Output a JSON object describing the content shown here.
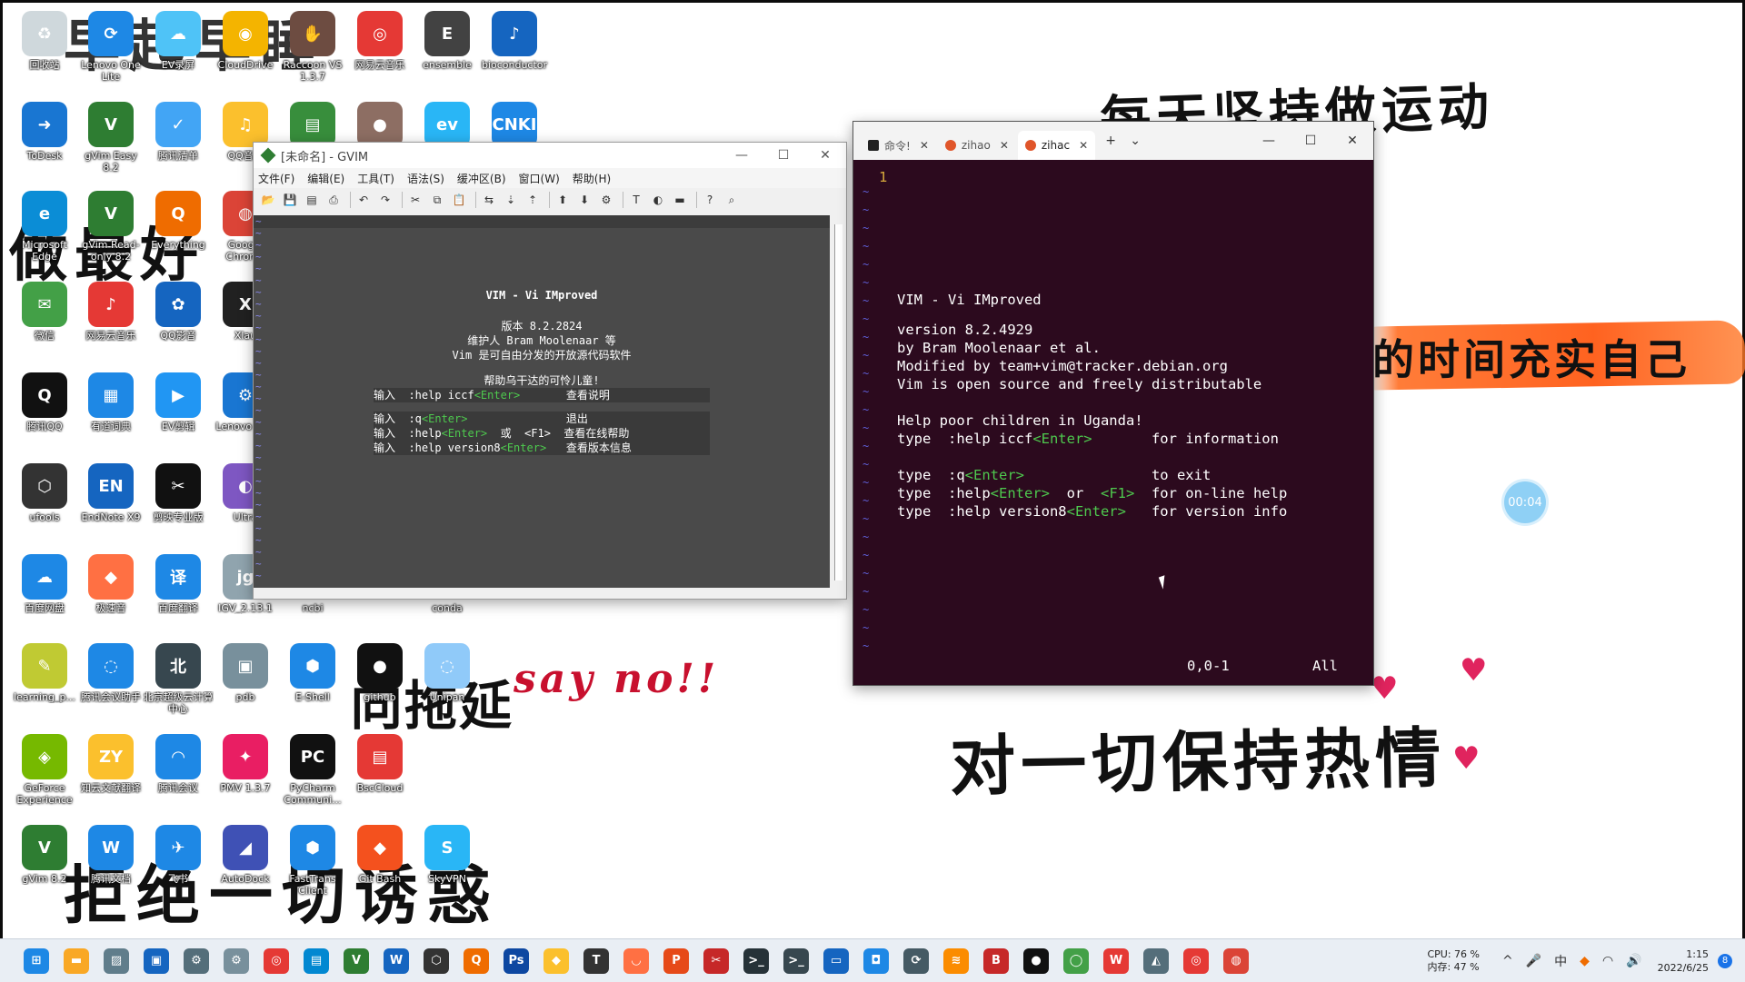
{
  "wallpaper": {
    "line1": "每天坚持做运动",
    "line2": "对一切保持热情",
    "line3": "say no!!",
    "line4": "向拖延",
    "line5": "拒绝一切诱惑",
    "line6": "早起早睡",
    "line7": "做最好",
    "line8": "的时间充实自己",
    "heart": "♥",
    "recorder_time": "00:04"
  },
  "desktop_icons": [
    {
      "label": "回收站",
      "glyph": "♻",
      "color": "#cfd8dc"
    },
    {
      "label": "Lenovo One Lite",
      "glyph": "⟳",
      "color": "#1e88e5"
    },
    {
      "label": "EV录屏",
      "glyph": "☁",
      "color": "#4fc3f7"
    },
    {
      "label": "CloudDrive",
      "glyph": "◉",
      "color": "#f4b400"
    },
    {
      "label": "Raccoon VS 1.3.7",
      "glyph": "✋",
      "color": "#6d4c41"
    },
    {
      "label": "网易云音乐",
      "glyph": "◎",
      "color": "#e53935"
    },
    {
      "label": "ensemble",
      "glyph": "E",
      "color": "#424242"
    },
    {
      "label": "bioconductor",
      "glyph": "♪",
      "color": "#1565c0"
    },
    {
      "label": "ToDesk",
      "glyph": "➜",
      "color": "#1976d2"
    },
    {
      "label": "gVim Easy 8.2",
      "glyph": "V",
      "color": "#2e7d32"
    },
    {
      "label": "腾讯清单",
      "glyph": "✓",
      "color": "#42a5f5"
    },
    {
      "label": "QQ音乐",
      "glyph": "♫",
      "color": "#fbc02d"
    },
    {
      "label": "",
      "glyph": "▤",
      "color": "#388e3c"
    },
    {
      "label": "",
      "glyph": "●",
      "color": "#8d6e63"
    },
    {
      "label": "",
      "glyph": "ev",
      "color": "#29b6f6"
    },
    {
      "label": "",
      "glyph": "CNKI",
      "color": "#1e88e5"
    },
    {
      "label": "Microsoft Edge",
      "glyph": "e",
      "color": "#0b8dd6"
    },
    {
      "label": "gVim Read-only 8.2",
      "glyph": "V",
      "color": "#2e7d32"
    },
    {
      "label": "Everything",
      "glyph": "Q",
      "color": "#ef6c00"
    },
    {
      "label": "Google Chrome",
      "glyph": "◍",
      "color": "#db4437"
    },
    {
      "label": "微信",
      "glyph": "✉",
      "color": "#43a047"
    },
    {
      "label": "网易云音乐",
      "glyph": "♪",
      "color": "#e53935"
    },
    {
      "label": "QQ影音",
      "glyph": "✿",
      "color": "#1565c0"
    },
    {
      "label": "Xlau",
      "glyph": "X",
      "color": "#212121"
    },
    {
      "label": "腾讯QQ",
      "glyph": "Q",
      "color": "#111111"
    },
    {
      "label": "有道词典",
      "glyph": "▦",
      "color": "#1e88e5"
    },
    {
      "label": "EV剪辑",
      "glyph": "▶",
      "color": "#2196f3"
    },
    {
      "label": "Lenovo 驱动",
      "glyph": "⚙",
      "color": "#1976d2"
    },
    {
      "label": "ufools",
      "glyph": "⬡",
      "color": "#333333"
    },
    {
      "label": "EndNote X9",
      "glyph": "EN",
      "color": "#1565c0"
    },
    {
      "label": "剪映专业版",
      "glyph": "✂",
      "color": "#111111"
    },
    {
      "label": "Ultra",
      "glyph": "◐",
      "color": "#7e57c2"
    },
    {
      "label": "百度网盘",
      "glyph": "☁",
      "color": "#1e88e5"
    },
    {
      "label": "极速音",
      "glyph": "◆",
      "color": "#ff7043"
    },
    {
      "label": "百度翻译",
      "glyph": "译",
      "color": "#1e88e5"
    },
    {
      "label": "IGV_2.13.1",
      "glyph": "jg",
      "color": "#90a4ae"
    },
    {
      "label": "ncbi",
      "glyph": "",
      "color": "transparent"
    },
    {
      "label": "conda",
      "glyph": "",
      "color": "transparent"
    },
    {
      "label": "learning_p...",
      "glyph": "✎",
      "color": "#c0ca33"
    },
    {
      "label": "腾讯会议助手",
      "glyph": "◌",
      "color": "#1e88e5"
    },
    {
      "label": "北京超级云计算中心",
      "glyph": "北",
      "color": "#37474f"
    },
    {
      "label": "pdb",
      "glyph": "▣",
      "color": "#78909c"
    },
    {
      "label": "E-Shell",
      "glyph": "⬢",
      "color": "#1e88e5"
    },
    {
      "label": "github",
      "glyph": "●",
      "color": "#111111"
    },
    {
      "label": "Unipan",
      "glyph": "◌",
      "color": "#90caf9"
    },
    {
      "label": "GeForce Experience",
      "glyph": "◈",
      "color": "#76b900"
    },
    {
      "label": "知云文献翻译",
      "glyph": "ZY",
      "color": "#fbc02d"
    },
    {
      "label": "腾讯会议",
      "glyph": "◠",
      "color": "#1e88e5"
    },
    {
      "label": "PMV 1.3.7",
      "glyph": "✦",
      "color": "#e91e63"
    },
    {
      "label": "PyCharm Communi...",
      "glyph": "PC",
      "color": "#111111"
    },
    {
      "label": "BscCloud",
      "glyph": "▤",
      "color": "#e53935"
    },
    {
      "label": "gVim 8.2",
      "glyph": "V",
      "color": "#2e7d32"
    },
    {
      "label": "腾讯文档",
      "glyph": "W",
      "color": "#1e88e5"
    },
    {
      "label": "飞书",
      "glyph": "✈",
      "color": "#1e88e5"
    },
    {
      "label": "AutoDock",
      "glyph": "◢",
      "color": "#3f51b5"
    },
    {
      "label": "FastTrans Client",
      "glyph": "⬢",
      "color": "#1e88e5"
    },
    {
      "label": "Git Bash",
      "glyph": "◆",
      "color": "#f4511e"
    },
    {
      "label": "SkyVPN",
      "glyph": "S",
      "color": "#29b6f6"
    }
  ],
  "gvim": {
    "title": "[未命名] - GVIM",
    "menu": [
      "文件(F)",
      "编辑(E)",
      "工具(T)",
      "语法(S)",
      "缓冲区(B)",
      "窗口(W)",
      "帮助(H)"
    ],
    "toolbar_icons": [
      "open-icon",
      "save-icon",
      "save-all-icon",
      "print-icon",
      "undo-icon",
      "redo-icon",
      "cut-icon",
      "copy-icon",
      "paste-icon",
      "replace-icon",
      "find-next-icon",
      "find-prev-icon",
      "load-session-icon",
      "save-session-icon",
      "run-script-icon",
      "make-icon",
      "shell-icon",
      "tags-icon",
      "help-icon",
      "find-help-icon"
    ],
    "toolbar_glyphs": [
      "📂",
      "💾",
      "▤",
      "⎙",
      "↶",
      "↷",
      "✂",
      "⧉",
      "📋",
      "⇆",
      "⇣",
      "⇡",
      "⬆",
      "⬇",
      "⚙",
      "T",
      "◐",
      "▬",
      "?",
      "⌕"
    ],
    "intro": {
      "title": "VIM - Vi IMproved",
      "version": "版本 8.2.2824",
      "maintainer": "维护人 Bram Moolenaar 等",
      "license": "Vim 是可自由分发的开放源代码软件",
      "help_title": "帮助乌干达的可怜儿童!",
      "rows": [
        {
          "a": "输入  ",
          "b": ":help iccf",
          "c": "<Enter>",
          "d": "       查看说明"
        },
        {
          "a": "输入  ",
          "b": ":q",
          "c": "<Enter>",
          "d": "               退出"
        },
        {
          "a": "输入  ",
          "b": ":help",
          "c": "<Enter>",
          "d": "  或  <F1>  查看在线帮助"
        },
        {
          "a": "输入  ",
          "b": ":help version8",
          "c": "<Enter>",
          "d": "   查看版本信息"
        }
      ]
    }
  },
  "terminal": {
    "tabs": [
      {
        "label": "命令!",
        "icon": "cmd"
      },
      {
        "label": "zihao",
        "icon": "ubuntu"
      },
      {
        "label": "zihac",
        "icon": "ubuntu"
      }
    ],
    "new_tab": "+",
    "dropdown": "⌄",
    "line_number": "1",
    "lines": [
      {
        "text": "VIM - Vi IMproved",
        "indent": 18
      },
      {
        "text": "",
        "indent": 0
      },
      {
        "text": "version 8.2.4929",
        "indent": 19
      },
      {
        "text": "by Bram Moolenaar et al.",
        "indent": 15
      },
      {
        "text": "Modified by team+vim@tracker.debian.org",
        "indent": 7
      },
      {
        "text": "Vim is open source and freely distributable",
        "indent": 5
      }
    ],
    "help_line": "Help poor children in Uganda!",
    "help_rows": [
      {
        "pre": "type  :help iccf",
        "key": "<Enter>",
        "post": "       for information"
      },
      {
        "pre": "type  :q",
        "key": "<Enter>",
        "post": "               to exit"
      },
      {
        "pre": "type  :help",
        "key": "<Enter>",
        "post": "  or  ",
        "key2": "<F1>",
        "post2": "  for on-line help"
      },
      {
        "pre": "type  :help version8",
        "key": "<Enter>",
        "post": "   for version info"
      }
    ],
    "status_pos": "0,0-1",
    "status_all": "All"
  },
  "taskbar": {
    "apps": [
      {
        "name": "start-icon",
        "glyph": "⊞",
        "color": "#1e88e5"
      },
      {
        "name": "file-explorer-icon",
        "glyph": "▬",
        "color": "#f9a825"
      },
      {
        "name": "photos-icon",
        "glyph": "▨",
        "color": "#607d8b"
      },
      {
        "name": "store-icon",
        "glyph": "▣",
        "color": "#1565c0"
      },
      {
        "name": "settings-icon",
        "glyph": "⚙",
        "color": "#546e7a"
      },
      {
        "name": "control-icon",
        "glyph": "⚙",
        "color": "#78909c"
      },
      {
        "name": "netease-music-icon",
        "glyph": "◎",
        "color": "#e53935"
      },
      {
        "name": "screen-icon",
        "glyph": "▤",
        "color": "#0288d1"
      },
      {
        "name": "gvim-icon",
        "glyph": "V",
        "color": "#2e7d32"
      },
      {
        "name": "word-icon",
        "glyph": "W",
        "color": "#1565c0"
      },
      {
        "name": "ufools-icon",
        "glyph": "⬡",
        "color": "#333333"
      },
      {
        "name": "everything-icon",
        "glyph": "Q",
        "color": "#ef6c00"
      },
      {
        "name": "photoshop-icon",
        "glyph": "Ps",
        "color": "#0d47a1"
      },
      {
        "name": "app-icon",
        "glyph": "◆",
        "color": "#fbc02d"
      },
      {
        "name": "typora-icon",
        "glyph": "T",
        "color": "#333333"
      },
      {
        "name": "arc-icon",
        "glyph": "◡",
        "color": "#ff7043"
      },
      {
        "name": "powerpoint-icon",
        "glyph": "P",
        "color": "#e64a19"
      },
      {
        "name": "capcut-icon",
        "glyph": "✂",
        "color": "#c62828"
      },
      {
        "name": "terminal-icon",
        "glyph": ">_",
        "color": "#263238"
      },
      {
        "name": "cmd-icon",
        "glyph": ">_",
        "color": "#37474f"
      },
      {
        "name": "remote-icon",
        "glyph": "▭",
        "color": "#1565c0"
      },
      {
        "name": "meeting-icon",
        "glyph": "◘",
        "color": "#1e88e5"
      },
      {
        "name": "link-icon",
        "glyph": "⟳",
        "color": "#455a64"
      },
      {
        "name": "ev-icon",
        "glyph": "≋",
        "color": "#fb8c00"
      },
      {
        "name": "bilibili-icon",
        "glyph": "B",
        "color": "#c62828"
      },
      {
        "name": "github-icon",
        "glyph": "●",
        "color": "#111111"
      },
      {
        "name": "circle-icon",
        "glyph": "◯",
        "color": "#43a047"
      },
      {
        "name": "wps-icon",
        "glyph": "W",
        "color": "#e53935"
      },
      {
        "name": "cap-icon",
        "glyph": "◭",
        "color": "#546e7a"
      },
      {
        "name": "music-icon",
        "glyph": "◎",
        "color": "#e53935"
      },
      {
        "name": "chrome-icon",
        "glyph": "◍",
        "color": "#db4437"
      }
    ],
    "perf_cpu": "CPU: 76 %",
    "perf_mem": "内存: 47 %",
    "tray_up": "^",
    "tray_mic": "🎤",
    "tray_ime": "中",
    "tray_app": "◆",
    "tray_wifi": "◠",
    "tray_volume": "🔊",
    "time": "1:15",
    "date": "2022/6/25",
    "notifications": "8"
  }
}
